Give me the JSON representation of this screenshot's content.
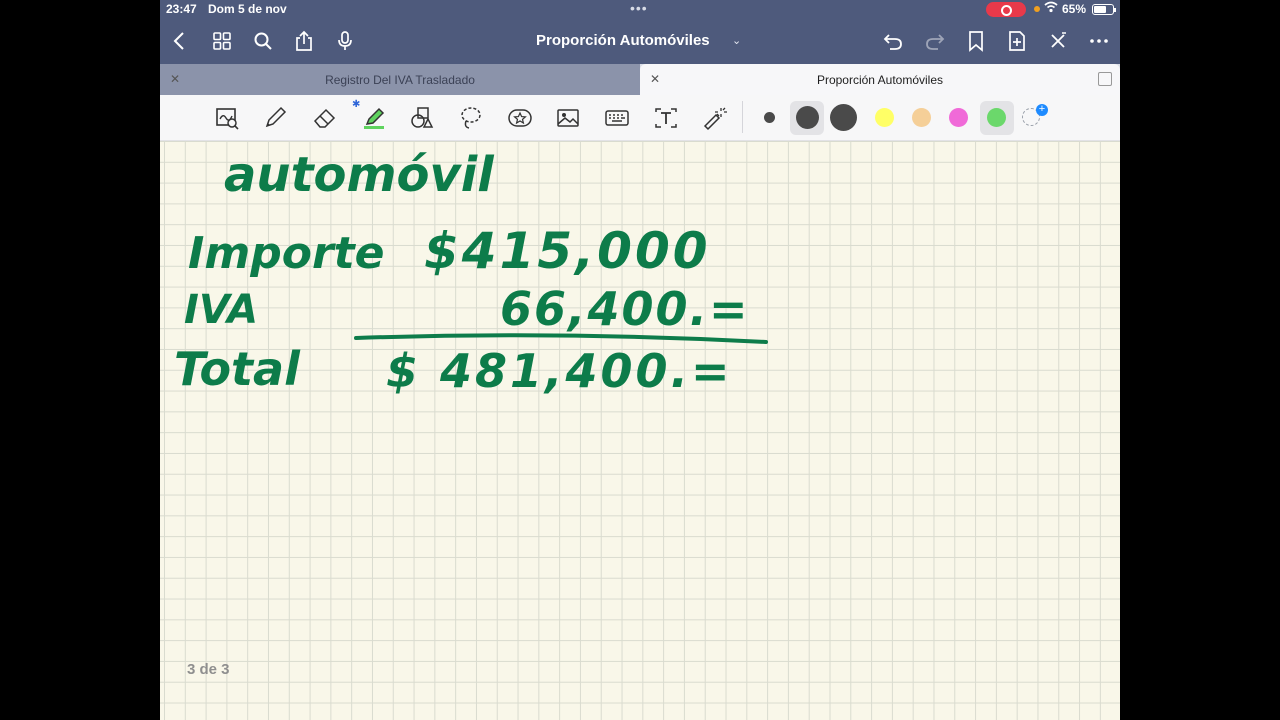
{
  "status_bar": {
    "time": "23:47",
    "date": "Dom 5 de nov",
    "battery": "65%"
  },
  "nav_bar": {
    "document_title": "Proporción Automóviles"
  },
  "tabs": [
    {
      "label": "Registro Del IVA Trasladado",
      "active": false
    },
    {
      "label": "Proporción Automóviles",
      "active": true
    }
  ],
  "toolbar": {
    "tools": [
      "zoom-select-icon",
      "pen-icon",
      "eraser-icon",
      "highlighter-icon",
      "shapes-icon",
      "lasso-icon",
      "sticker-icon",
      "image-icon",
      "keyboard-icon",
      "text-box-icon",
      "laser-pointer-icon"
    ],
    "colors": [
      "#4a4a4a",
      "#ffff66",
      "#f5cf98",
      "#f06ad8",
      "#6bd86b"
    ]
  },
  "note": {
    "ink_color": "#0d7c4a",
    "heading": "automóvil",
    "rows": [
      {
        "label": "Importe",
        "value": "$415,000"
      },
      {
        "label": "IVA",
        "value": "66,400.="
      },
      {
        "label": "Total",
        "value": "$ 481,400.="
      }
    ]
  },
  "page_counter": "3 de 3"
}
